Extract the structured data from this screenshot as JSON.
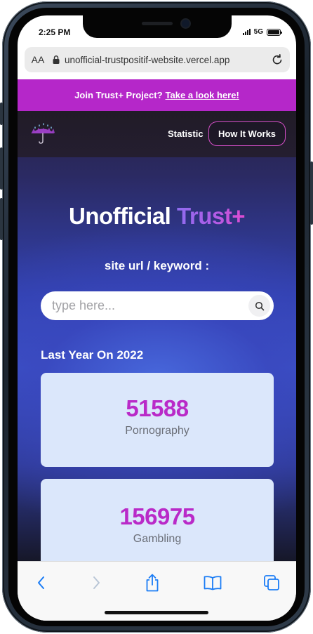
{
  "status_bar": {
    "time": "2:25 PM",
    "network": "5G"
  },
  "browser": {
    "aa_label": "AA",
    "url": "unofficial-trustpositif-website.vercel.app"
  },
  "announcement": {
    "text": "Join Trust+ Project?",
    "link_label": "Take a look here!"
  },
  "nav": {
    "statistic_label": "Statistic",
    "how_it_works_label": "How It Works"
  },
  "hero": {
    "title_plain": "Unofficial",
    "title_brand": "Trust+",
    "subtitle": "site url / keyword :"
  },
  "search": {
    "placeholder": "type here...",
    "value": ""
  },
  "stats": {
    "section_title": "Last Year On 2022",
    "items": [
      {
        "value": "51588",
        "label": "Pornography"
      },
      {
        "value": "156975",
        "label": "Gambling"
      }
    ]
  },
  "colors": {
    "accent": "#b527c9",
    "stat_value": "#b92ac8",
    "card_bg": "#dbe7fb",
    "ios_blue": "#1a7cf5"
  },
  "icons": {
    "logo": "umbrella-icon",
    "lock": "lock-icon",
    "reload": "reload-icon",
    "search": "search-icon",
    "back": "chevron-left-icon",
    "forward": "chevron-right-icon",
    "share": "share-icon",
    "bookmarks": "book-icon",
    "tabs": "tabs-icon"
  }
}
